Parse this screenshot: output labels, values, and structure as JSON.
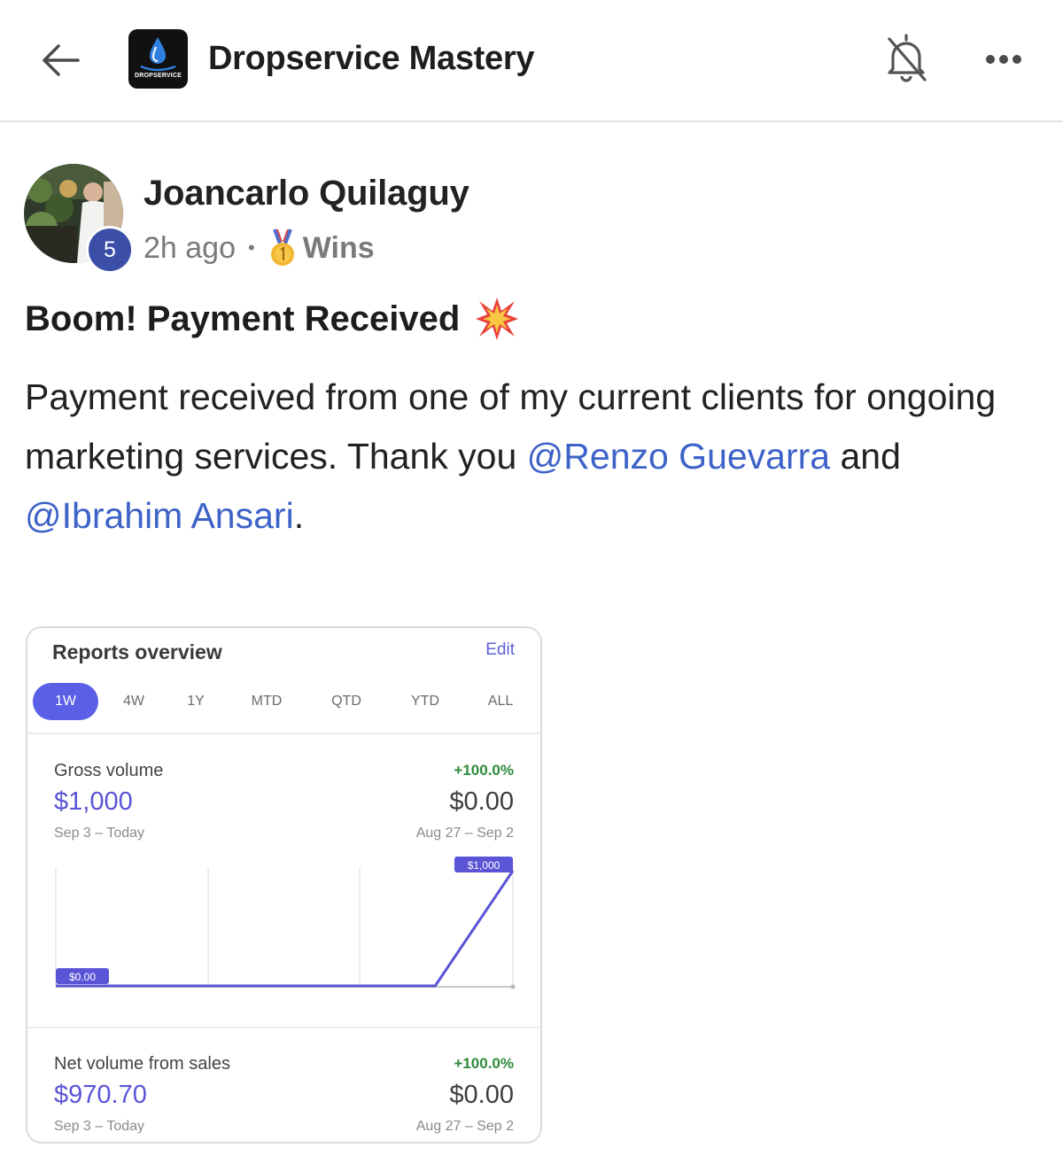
{
  "header": {
    "title": "Dropservice Mastery",
    "logo_text": "DROPSERVICE",
    "back_icon": "arrow-left-icon",
    "bell_icon": "bell-muted-icon",
    "more_icon": "more-dots-icon"
  },
  "post": {
    "author": "Joancarlo Quilaguy",
    "level": "5",
    "time": "2h ago",
    "separator": "•",
    "category": "Wins",
    "title": "Boom! Payment Received",
    "body_part1": "Payment received from one of my current clients for ongoing marketing services. Thank you ",
    "mention1": "@Renzo Guevarra",
    "body_part2": " and ",
    "mention2": "@Ibrahim Ansari",
    "body_part3": "."
  },
  "report": {
    "title": "Reports overview",
    "edit": "Edit",
    "tabs": [
      "1W",
      "4W",
      "1Y",
      "MTD",
      "QTD",
      "YTD",
      "ALL"
    ],
    "active_tab": "1W",
    "gross": {
      "label": "Gross volume",
      "value": "$1,000",
      "range": "Sep 3 – Today",
      "pct": "+100.0%",
      "prev_value": "$0.00",
      "prev_range": "Aug 27 – Sep 2"
    },
    "net": {
      "label": "Net volume from sales",
      "value": "$970.70",
      "range": "Sep 3 – Today",
      "pct": "+100.0%",
      "prev_value": "$0.00",
      "prev_range": "Aug 27 – Sep 2"
    }
  },
  "chart_data": {
    "type": "line",
    "series": [
      {
        "values": [
          0,
          0,
          0,
          0,
          1000
        ]
      }
    ],
    "labels": {
      "max": "$1,000",
      "min": "$0.00"
    },
    "ylim": [
      0,
      1000
    ],
    "accent": "#5a54d6"
  }
}
